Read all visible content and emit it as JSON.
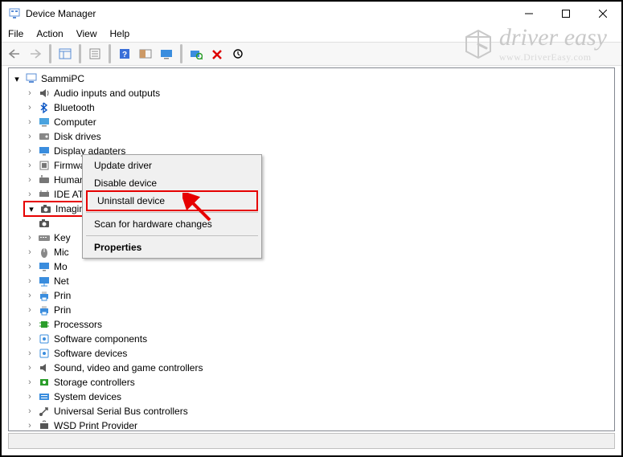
{
  "window": {
    "title": "Device Manager"
  },
  "menu": {
    "file": "File",
    "action": "Action",
    "view": "View",
    "help": "Help"
  },
  "watermark": {
    "main": "driver easy",
    "sub": "www.DriverEasy.com"
  },
  "tree": {
    "root": "SammiPC",
    "items": [
      {
        "label": "Audio inputs and outputs"
      },
      {
        "label": "Bluetooth"
      },
      {
        "label": "Computer"
      },
      {
        "label": "Disk drives"
      },
      {
        "label": "Display adapters"
      },
      {
        "label": "Firmware"
      },
      {
        "label": "Human Interface Devices"
      },
      {
        "label": "IDE ATA/ATAPI controllers"
      },
      {
        "label": "Imaging devices",
        "expanded": true,
        "highlight": true
      },
      {
        "label": "Key"
      },
      {
        "label": "Mic"
      },
      {
        "label": "Mo"
      },
      {
        "label": "Net"
      },
      {
        "label": "Prin"
      },
      {
        "label": "Prin"
      },
      {
        "label": "Processors"
      },
      {
        "label": "Software components"
      },
      {
        "label": "Software devices"
      },
      {
        "label": "Sound, video and game controllers"
      },
      {
        "label": "Storage controllers"
      },
      {
        "label": "System devices"
      },
      {
        "label": "Universal Serial Bus controllers"
      },
      {
        "label": "WSD Print Provider"
      }
    ]
  },
  "context_menu": {
    "update": "Update driver",
    "disable": "Disable device",
    "uninstall": "Uninstall device",
    "scan": "Scan for hardware changes",
    "properties": "Properties"
  },
  "icons": {
    "audio": "#5a5a5a",
    "bluetooth": "#0a55c4",
    "computer": "#4aa3df",
    "disk": "#888",
    "display": "#3a8dde",
    "firmware": "#777",
    "hid": "#777",
    "ide": "#777",
    "imaging": "#555",
    "keyboard": "#888",
    "mouse": "#888",
    "monitor": "#3a8dde",
    "network": "#3a8dde",
    "printer": "#3a8dde",
    "processor": "#2a9d2a",
    "softcomp": "#3a8dde",
    "softdev": "#3a8dde",
    "sound": "#5a5a5a",
    "storage": "#2a9d2a",
    "system": "#3a8dde",
    "usb": "#555",
    "wsd": "#555"
  }
}
